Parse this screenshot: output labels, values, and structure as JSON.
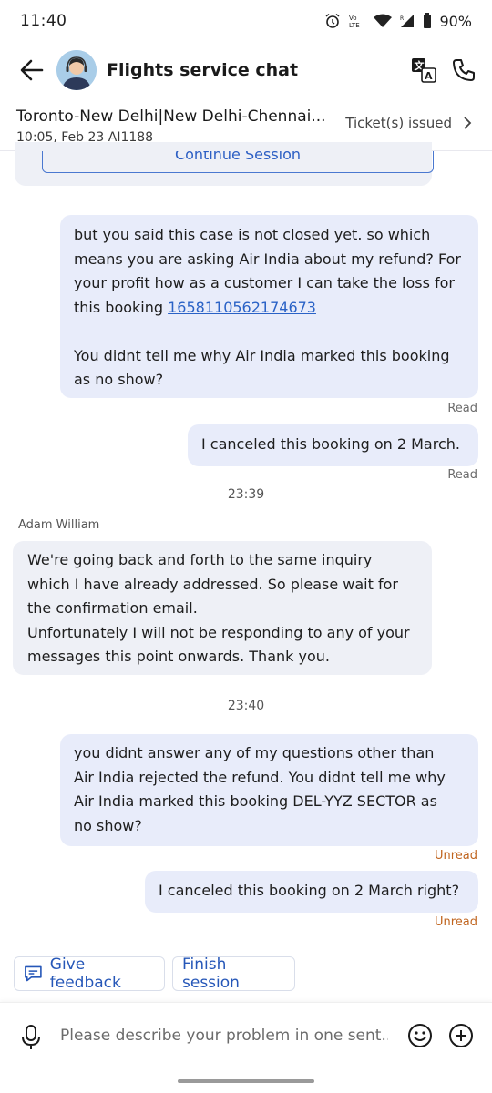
{
  "status_bar": {
    "time": "11:40",
    "battery": "90%"
  },
  "header": {
    "title": "Flights service chat"
  },
  "trip": {
    "route": "Toronto-New Delhi|New Delhi-Chennai...",
    "details": "10:05, Feb 23 AI1188",
    "status": "Ticket(s) issued"
  },
  "chat": {
    "continue_label": "Continue Session",
    "msg1": {
      "line1": "but you said this case is not closed yet. so which",
      "line2": "means you are asking Air India about my refund? For",
      "line3": "your profit how as a customer I can take the loss for",
      "line4_prefix": "this booking ",
      "booking_link": "1658110562174673",
      "line5": "You didnt tell me why Air India marked this booking",
      "line6": "as no show?",
      "status": "Read"
    },
    "msg2": {
      "text": "I canceled this booking on 2 March.",
      "status": "Read"
    },
    "time1": "23:39",
    "agent_name": "Adam William",
    "agent_msg": {
      "line1": "We're going back and forth to the same inquiry",
      "line2": "which I have already addressed. So please wait for",
      "line3": "the confirmation email.",
      "line4": "Unfortunately I will not be responding to any of your",
      "line5": "messages this point onwards. Thank you."
    },
    "time2": "23:40",
    "msg3": {
      "line1": "you didnt answer any of my questions other than",
      "line2": "Air India rejected the refund. You didnt tell me why",
      "line3": "Air India marked this booking DEL-YYZ SECTOR as",
      "line4": "no show?",
      "status": "Unread"
    },
    "msg4": {
      "text": "I canceled this booking on 2 March right?",
      "status": "Unread"
    }
  },
  "actions": {
    "feedback": "Give feedback",
    "finish": "Finish session"
  },
  "input": {
    "placeholder": "Please describe your problem in one sent..."
  },
  "icons": [
    "back-arrow-icon",
    "agent-avatar",
    "translate-icon",
    "phone-icon",
    "chevron-right-icon",
    "feedback-icon",
    "mic-icon",
    "emoji-icon",
    "plus-icon"
  ],
  "colors": {
    "link": "#2a62c6",
    "unread": "#c0641e",
    "bubble_user": "#e8ecfa",
    "bubble_agent": "#eef0f6"
  }
}
